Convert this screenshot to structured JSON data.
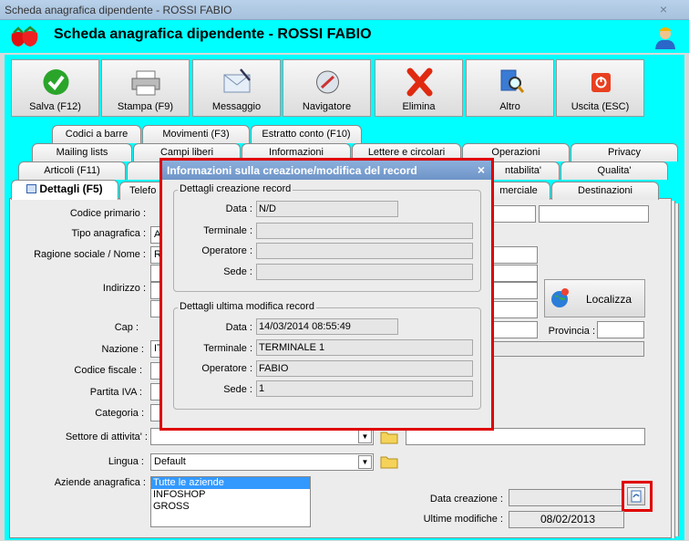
{
  "window": {
    "title": "Scheda anagrafica dipendente - ROSSI FABIO",
    "close_glyph": "×"
  },
  "header": {
    "title": "Scheda anagrafica dipendente - ROSSI FABIO"
  },
  "toolbar": [
    {
      "label": "Salva (F12)",
      "icon": "check-icon"
    },
    {
      "label": "Stampa (F9)",
      "icon": "printer-icon"
    },
    {
      "label": "Messaggio",
      "icon": "envelope-icon"
    },
    {
      "label": "Navigatore",
      "icon": "compass-icon"
    },
    {
      "label": "Elimina",
      "icon": "delete-x-icon"
    },
    {
      "label": "Altro",
      "icon": "search-doc-icon"
    },
    {
      "label": "Uscita (ESC)",
      "icon": "exit-icon"
    }
  ],
  "tabs_row1": [
    "Codici a barre",
    "Movimenti (F3)",
    "Estratto conto (F10)"
  ],
  "tabs_row2": [
    "Mailing lists",
    "Campi liberi",
    "Informazioni",
    "Lettere e circolari",
    "Operazioni",
    "Privacy"
  ],
  "tabs_row3": [
    "Articoli (F11)",
    "",
    "",
    "",
    "ntabilita'",
    "Qualita'"
  ],
  "tabs_row4": [
    "Dettagli (F5)",
    "Telefo",
    "",
    "",
    "merciale",
    "Destinazioni"
  ],
  "form": {
    "codice_primario": "Codice primario :",
    "tipo_anagrafica": "Tipo anagrafica :",
    "tipo_value": "A",
    "ragione_sociale": "Ragione sociale / Nome :",
    "ragione_value": "R",
    "indirizzo": "Indirizzo :",
    "cap": "Cap :",
    "nazione": "Nazione :",
    "nazione_value": "IT",
    "codice_fiscale": "Codice fiscale :",
    "partita_iva": "Partita IVA :",
    "categoria": "Categoria :",
    "settore": "Settore di attivita' :",
    "lingua": "Lingua :",
    "lingua_value": "Default",
    "aziende": "Aziende anagrafica :",
    "aziende_list": [
      "Tutte le aziende",
      "INFOSHOP",
      "GROSS"
    ],
    "provincia": "Provincia :",
    "localizza": "Localizza",
    "data_creazione": "Data creazione :",
    "ultime_modifiche": "Ultime modifiche :",
    "ultime_value": "08/02/2013"
  },
  "dialog": {
    "title": "Informazioni sulla creazione/modifica del record",
    "close_glyph": "×",
    "creazione": {
      "legend": "Dettagli creazione record",
      "data_label": "Data :",
      "data": "N/D",
      "terminale_label": "Terminale :",
      "terminale": "",
      "operatore_label": "Operatore :",
      "operatore": "",
      "sede_label": "Sede :",
      "sede": ""
    },
    "modifica": {
      "legend": "Dettagli ultima modifica record",
      "data_label": "Data :",
      "data": "14/03/2014 08:55:49",
      "terminale_label": "Terminale :",
      "terminale": "TERMINALE 1",
      "operatore_label": "Operatore :",
      "operatore": "FABIO",
      "sede_label": "Sede :",
      "sede": "1"
    }
  },
  "colors": {
    "header_bg": "#00ffff",
    "highlight": "#e00000",
    "selection": "#3399ff"
  }
}
